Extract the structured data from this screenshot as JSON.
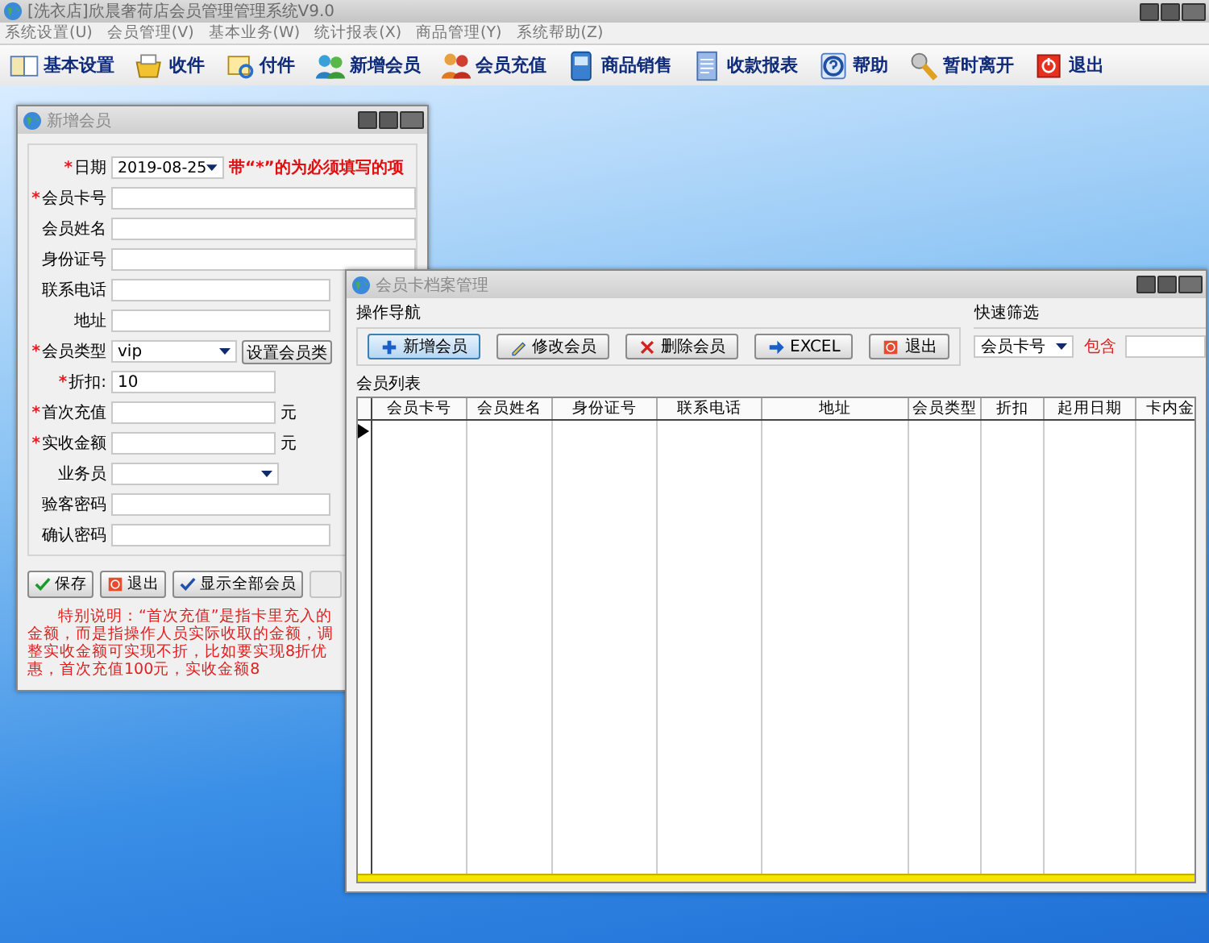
{
  "window": {
    "title": "[洗衣店]欣晨奢荷店会员管理管理系统V9.0"
  },
  "menu": [
    "系统设置(U)",
    "会员管理(V)",
    "基本业务(W)",
    "统计报表(X)",
    "商品管理(Y)",
    "系统帮助(Z)"
  ],
  "toolbar": [
    {
      "label": "基本设置"
    },
    {
      "label": "收件"
    },
    {
      "label": "付件"
    },
    {
      "label": "新增会员"
    },
    {
      "label": "会员充值"
    },
    {
      "label": "商品销售"
    },
    {
      "label": "收款报表"
    },
    {
      "label": "帮助"
    },
    {
      "label": "暂时离开"
    },
    {
      "label": "退出"
    }
  ],
  "new_member_dialog": {
    "title": "新增会员",
    "fields": [
      {
        "kind": "date",
        "star": "*",
        "label": "日期",
        "value": "2019-08-25",
        "hint": "带“*”的为必须填写的项"
      },
      {
        "kind": "text",
        "star": "*",
        "label": "会员卡号"
      },
      {
        "kind": "text",
        "label": "会员姓名"
      },
      {
        "kind": "text",
        "label": "身份证号"
      },
      {
        "kind": "text",
        "label": "联系电话"
      },
      {
        "kind": "text",
        "label": "地址"
      },
      {
        "kind": "select",
        "star": "*",
        "label": "会员类型",
        "value": "vip",
        "button": "设置会员类"
      },
      {
        "kind": "short",
        "star": "*",
        "label": "折扣:",
        "value": "10"
      },
      {
        "kind": "short",
        "star": "*",
        "label": "首次充值",
        "unit": "元"
      },
      {
        "kind": "short",
        "star": "*",
        "label": "实收金额",
        "unit": "元"
      },
      {
        "kind": "select_short",
        "label": "业务员"
      },
      {
        "kind": "text",
        "label": "验客密码"
      },
      {
        "kind": "text",
        "label": "确认密码"
      }
    ],
    "buttons": [
      {
        "label": "保存",
        "disabled": false
      },
      {
        "label": "退出",
        "disabled": false
      },
      {
        "label": "显示全部会员",
        "disabled": false
      },
      {
        "disabled": true
      }
    ],
    "note": "特别说明：“首次充值”是指卡里充入的金额，而是指操作人员实际收取的金额，调整实收金额可实现不折，比如要实现8折优惠，首次充值100元，实收金额8"
  },
  "member_card_window": {
    "title": "会员卡档案管理",
    "nav_group": "操作导航",
    "nav_buttons": [
      {
        "label": "新增会员",
        "selected": true
      },
      {
        "label": "修改会员",
        "selected": false
      },
      {
        "label": "删除会员",
        "selected": false
      },
      {
        "label": "EXCEL",
        "selected": false
      },
      {
        "label": "退出",
        "selected": false
      }
    ],
    "filter_group": "快速筛选",
    "filter_field": "会员卡号",
    "filter_op": "包含",
    "list_label": "会员列表",
    "table": {
      "columns": [
        "会员卡号",
        "会员姓名",
        "身份证号",
        "联系电话",
        "地址",
        "会员类型",
        "折扣",
        "起用日期",
        "卡内金"
      ]
    }
  }
}
